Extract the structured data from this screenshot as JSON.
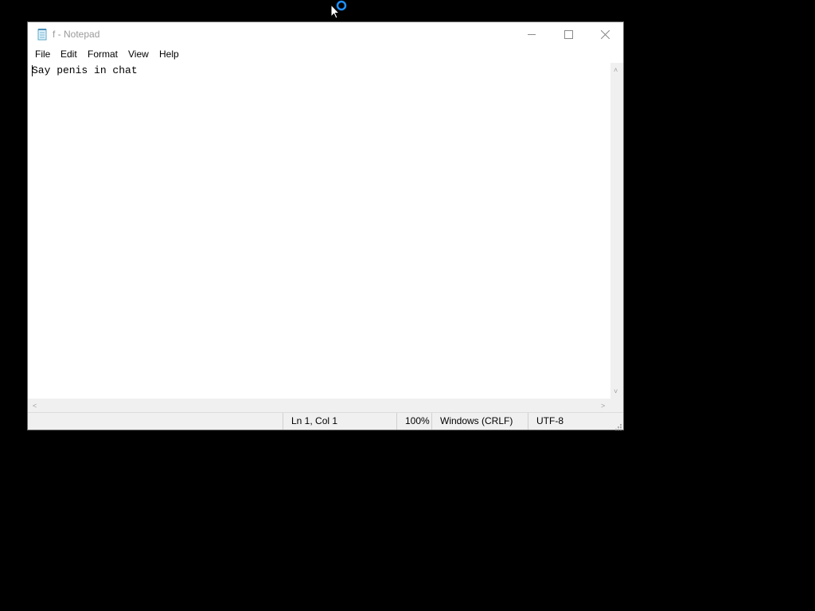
{
  "window": {
    "title": "f - Notepad",
    "app_icon": "notepad-icon"
  },
  "title_buttons": {
    "minimize_icon": "minimize-icon",
    "maximize_icon": "maximize-icon",
    "close_icon": "close-icon"
  },
  "menu": {
    "items": [
      {
        "label": "File"
      },
      {
        "label": "Edit"
      },
      {
        "label": "Format"
      },
      {
        "label": "View"
      },
      {
        "label": "Help"
      }
    ]
  },
  "editor": {
    "content": "Say penis in chat"
  },
  "scrollbars": {
    "up_arrow": "˄",
    "down_arrow": "˅",
    "left_arrow": "<",
    "right_arrow": ">"
  },
  "status": {
    "position": "Ln 1, Col 1",
    "zoom": "100%",
    "line_endings": "Windows (CRLF)",
    "encoding": "UTF-8"
  },
  "colors": {
    "desktop": "#000000",
    "window_bg": "#ffffff",
    "statusbar_bg": "#f0f0f0",
    "title_text": "#9a9a9a",
    "busy_ring": "#1e90ff"
  }
}
